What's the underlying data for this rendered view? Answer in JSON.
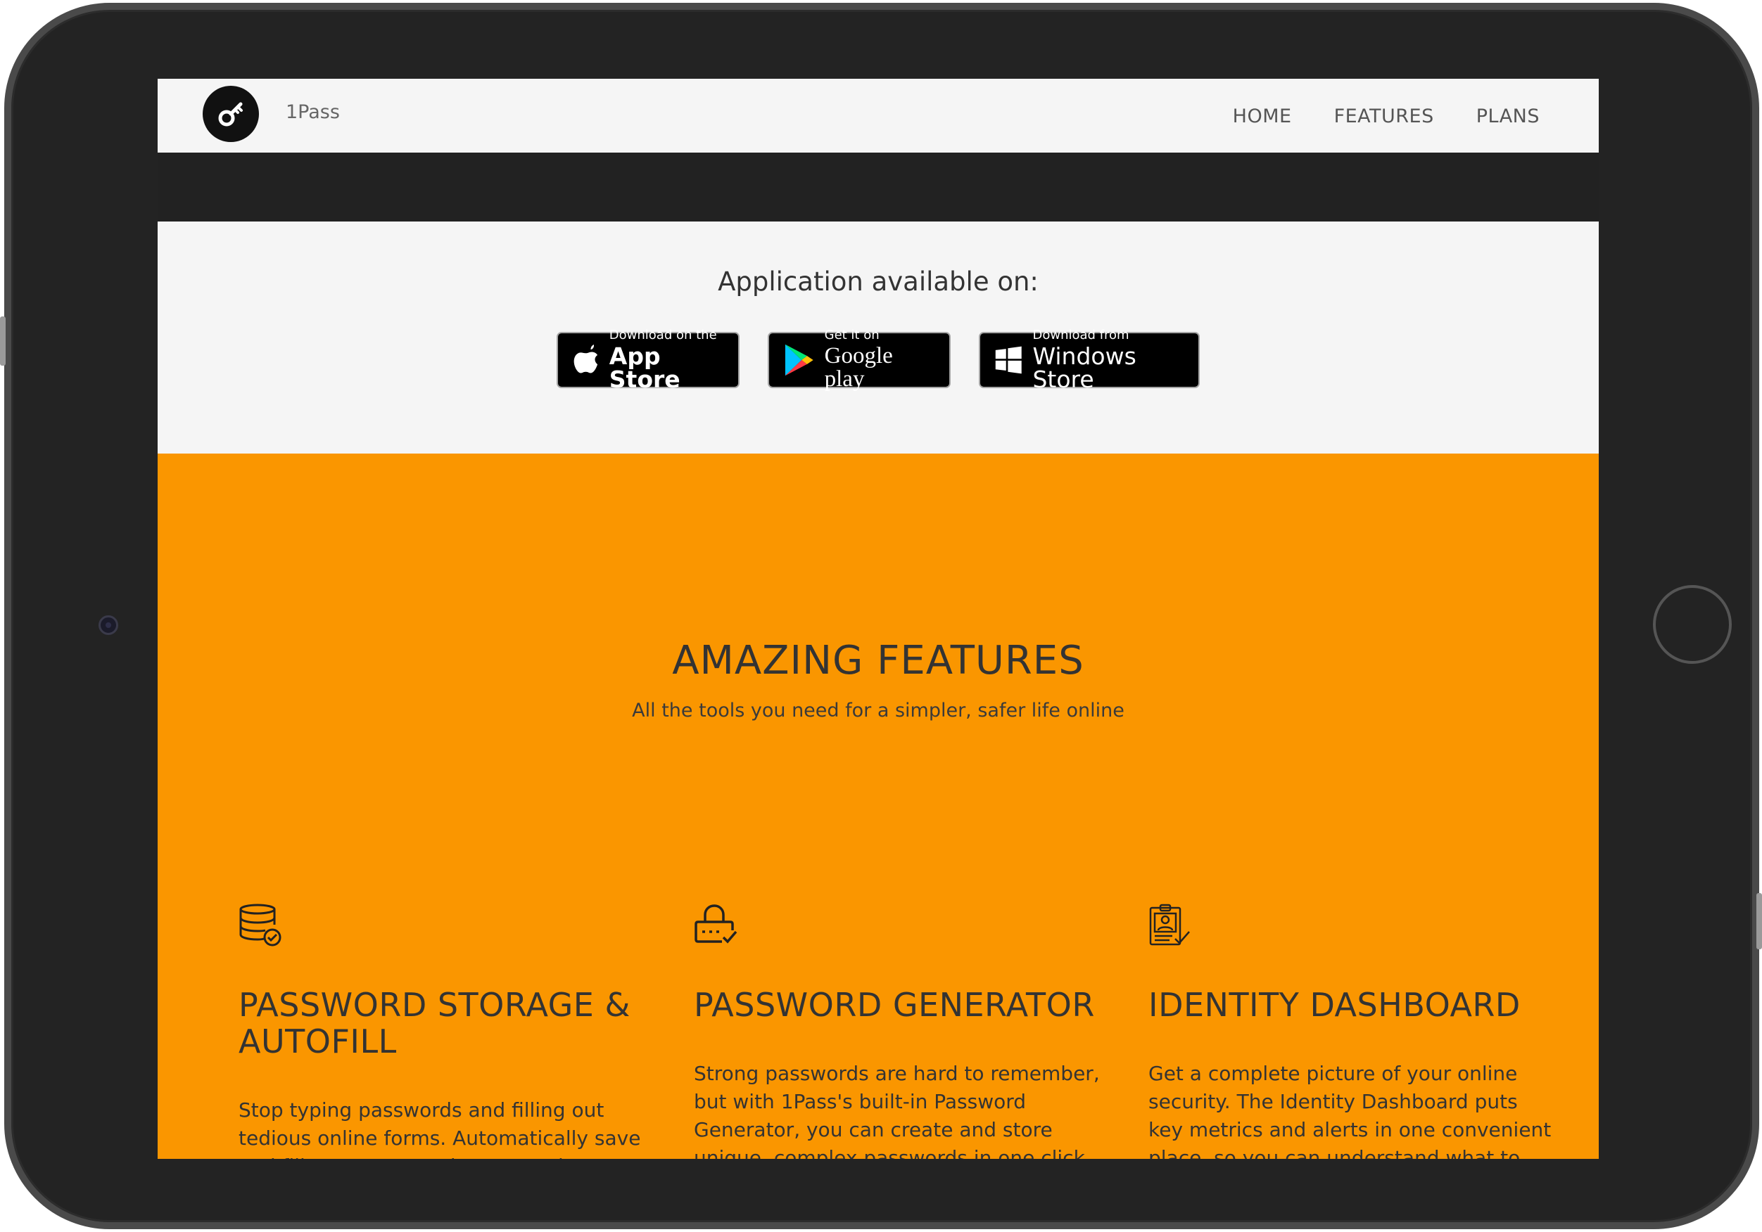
{
  "nav": {
    "brand": "1Pass",
    "menu": [
      {
        "label": "HOME"
      },
      {
        "label": "FEATURES"
      },
      {
        "label": "PLANS"
      }
    ]
  },
  "apps": {
    "title": "Application available on:",
    "badges": [
      {
        "small": "Download on the",
        "big": "App Store",
        "icon": "apple-icon"
      },
      {
        "small": "Get it on",
        "big": "Google play",
        "icon": "google-play-icon"
      },
      {
        "small": "Download from",
        "big": "Windows Store",
        "icon": "windows-icon"
      }
    ]
  },
  "features": {
    "title": "AMAZING FEATURES",
    "subtitle": "All the tools you need for a simpler, safer life online",
    "items": [
      {
        "icon": "database-check-icon",
        "title": "PASSWORD STORAGE & AUTOFILL",
        "text": "Stop typing passwords and filling out tedious online forms. Automatically save and fill your passwords, personal information, and payment details—quickly and accurately."
      },
      {
        "icon": "lock-check-icon",
        "title": "PASSWORD GENERATOR",
        "text": "Strong passwords are hard to remember, but with 1Pass's built-in Password Generator, you can create and store unique, complex passwords in one click when you create new accounts or change old passwords."
      },
      {
        "icon": "id-badge-check-icon",
        "title": "IDENTITY DASHBOARD",
        "text": "Get a complete picture of your online security. The Identity Dashboard puts key metrics and alerts in one convenient place, so you can understand what to improve and take steps to be more secure."
      }
    ]
  },
  "colors": {
    "accent": "#fa9600",
    "dark": "#222222",
    "light": "#f5f5f5"
  }
}
